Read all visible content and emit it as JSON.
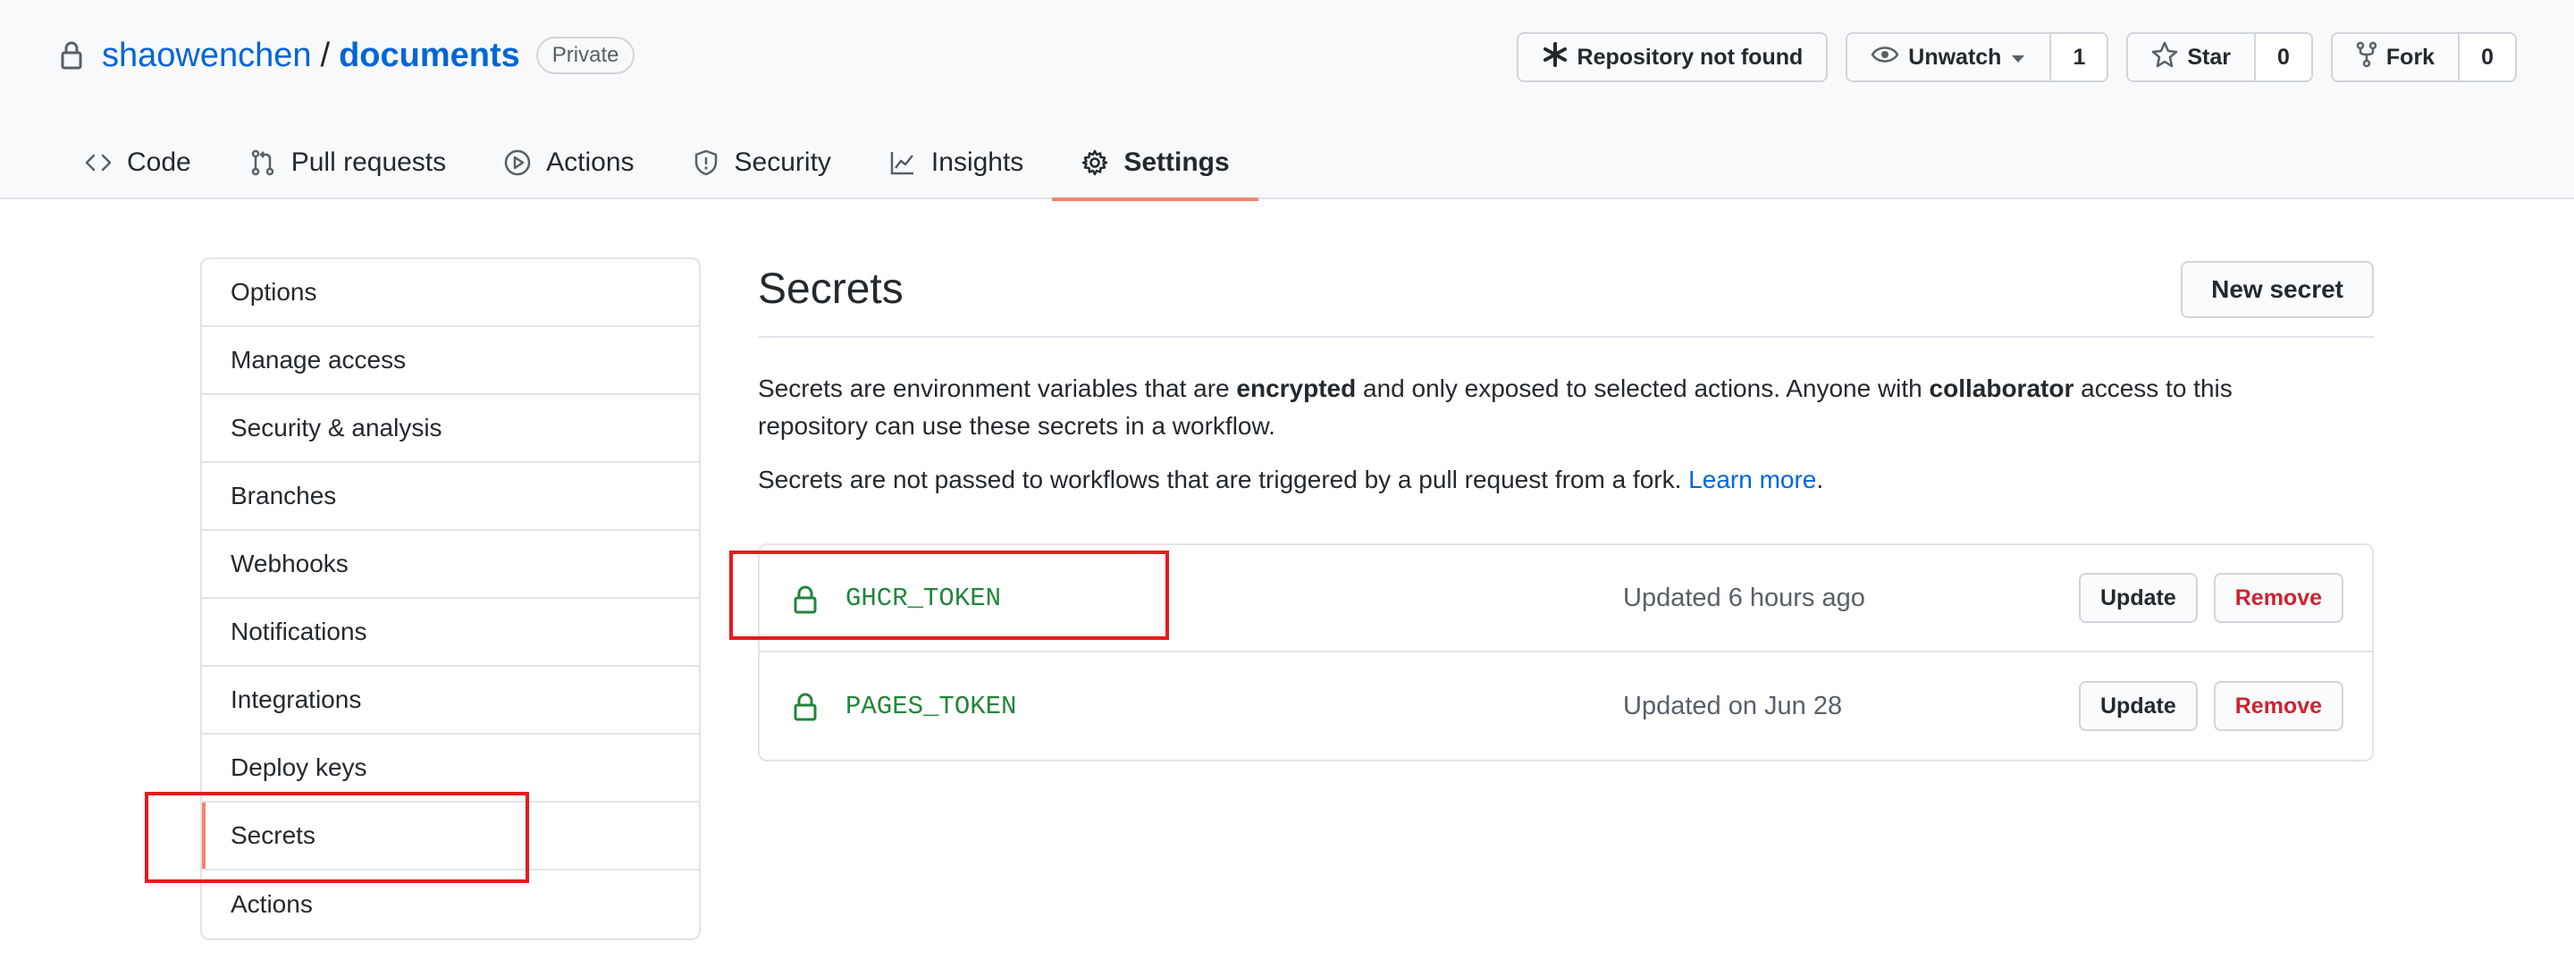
{
  "header": {
    "owner": "shaowenchen",
    "separator": "/",
    "repo": "documents",
    "visibility": "Private",
    "buttons": {
      "repo_not_found": "Repository not found",
      "unwatch": "Unwatch",
      "unwatch_count": "1",
      "star": "Star",
      "star_count": "0",
      "fork": "Fork",
      "fork_count": "0"
    },
    "tabs": [
      {
        "label": "Code",
        "icon": "code-icon"
      },
      {
        "label": "Pull requests",
        "icon": "pull-request-icon"
      },
      {
        "label": "Actions",
        "icon": "play-icon"
      },
      {
        "label": "Security",
        "icon": "shield-icon"
      },
      {
        "label": "Insights",
        "icon": "graph-icon"
      },
      {
        "label": "Settings",
        "icon": "gear-icon",
        "active": true
      }
    ]
  },
  "sidebar": {
    "items": [
      {
        "label": "Options"
      },
      {
        "label": "Manage access"
      },
      {
        "label": "Security & analysis"
      },
      {
        "label": "Branches"
      },
      {
        "label": "Webhooks"
      },
      {
        "label": "Notifications"
      },
      {
        "label": "Integrations"
      },
      {
        "label": "Deploy keys"
      },
      {
        "label": "Secrets",
        "selected": true
      },
      {
        "label": "Actions"
      }
    ]
  },
  "main": {
    "title": "Secrets",
    "new_secret_label": "New secret",
    "desc_part1": "Secrets are environment variables that are ",
    "desc_bold1": "encrypted",
    "desc_part2": " and only exposed to selected actions. Anyone with ",
    "desc_bold2": "collaborator",
    "desc_part3": " access to this repository can use these secrets in a workflow.",
    "desc2_text": "Secrets are not passed to workflows that are triggered by a pull request from a fork. ",
    "learn_more": "Learn more",
    "desc2_end": ".",
    "secrets": [
      {
        "name": "GHCR_TOKEN",
        "updated": "Updated 6 hours ago",
        "update_label": "Update",
        "remove_label": "Remove"
      },
      {
        "name": "PAGES_TOKEN",
        "updated": "Updated on Jun 28",
        "update_label": "Update",
        "remove_label": "Remove"
      }
    ]
  },
  "colors": {
    "accent_link": "#0366d6",
    "active_tab_underline": "#f9826c",
    "secret_name": "#22863a",
    "danger": "#cb2431",
    "annotation_box": "#e8191d"
  }
}
